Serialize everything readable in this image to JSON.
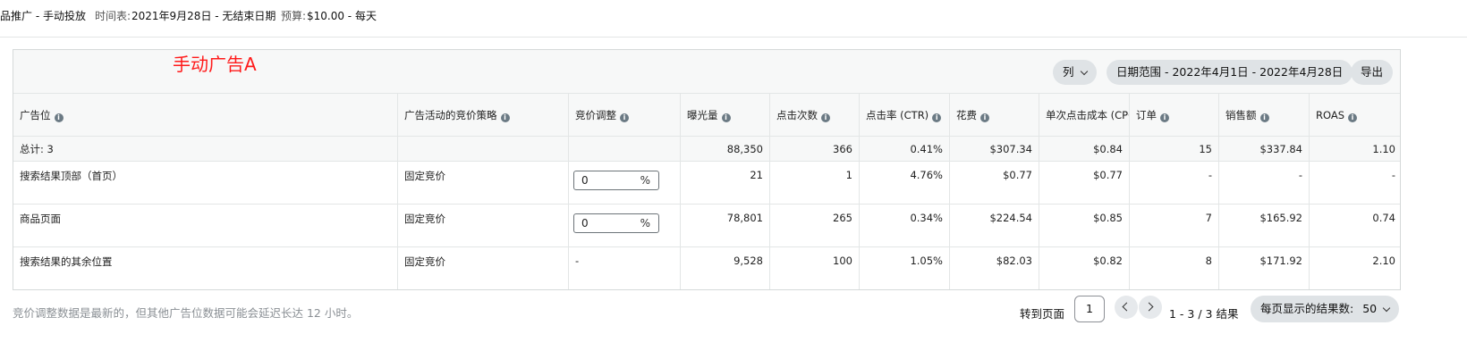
{
  "topbar": {
    "campaign": "品推广 - 手动投放",
    "schedule_label": "时间表:",
    "schedule_value": "2021年9月28日 - 无结束日期",
    "budget_label": "预算:",
    "budget_value": "$10.00 - 每天"
  },
  "annotation": "手动广告A",
  "toolbar": {
    "columns_label": "列",
    "date_range_label": "日期范围 - 2022年4月1日 - 2022年4月28日",
    "export_label": "导出"
  },
  "table": {
    "headers": [
      "广告位",
      "广告活动的竞价策略",
      "竞价调整",
      "曝光量",
      "点击次数",
      "点击率 (CTR)",
      "花费",
      "单次点击成本 (CPC)",
      "订单",
      "销售额",
      "ROAS"
    ],
    "total": [
      "总计: 3",
      "",
      "",
      "88,350",
      "366",
      "0.41%",
      "$307.34",
      "$0.84",
      "15",
      "$337.84",
      "1.10"
    ],
    "rows": [
      {
        "placement": "搜索结果顶部（首页）",
        "strategy": "固定竞价",
        "bid_value": "0",
        "bid_unit": "%",
        "impressions": "21",
        "clicks": "1",
        "ctr": "4.76%",
        "spend": "$0.77",
        "cpc": "$0.77",
        "orders": "-",
        "sales": "-",
        "roas": "-"
      },
      {
        "placement": "商品页面",
        "strategy": "固定竞价",
        "bid_value": "0",
        "bid_unit": "%",
        "impressions": "78,801",
        "clicks": "265",
        "ctr": "0.34%",
        "spend": "$224.54",
        "cpc": "$0.85",
        "orders": "7",
        "sales": "$165.92",
        "roas": "0.74"
      },
      {
        "placement": "搜索结果的其余位置",
        "strategy": "固定竞价",
        "bid_value": "-",
        "bid_unit": "",
        "impressions": "9,528",
        "clicks": "100",
        "ctr": "1.05%",
        "spend": "$82.03",
        "cpc": "$0.82",
        "orders": "8",
        "sales": "$171.92",
        "roas": "2.10"
      }
    ]
  },
  "footer": {
    "note": "竞价调整数据是最新的，但其他广告位数据可能会延迟长达 12 小时。",
    "goto_label": "转到页面",
    "page_value": "1",
    "results_text": "1 - 3 / 3 结果",
    "per_page_label": "每页显示的结果数:",
    "per_page_value": "50"
  }
}
